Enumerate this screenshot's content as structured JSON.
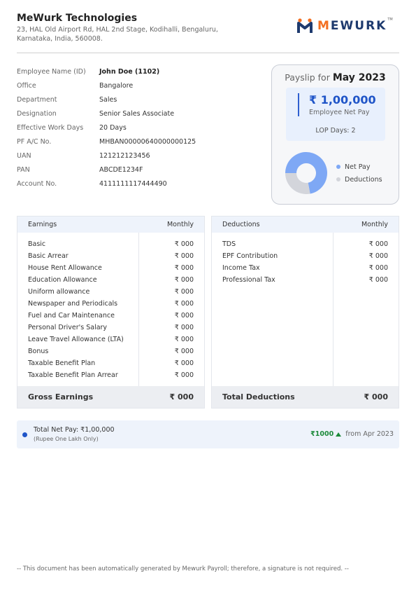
{
  "company": {
    "name": "MeWurk Technologies",
    "address": "23, HAL Old Airport Rd, HAL 2nd Stage, Kodihalli, Bengaluru, Karnataka, India, 560008.",
    "logo_text_m": "M",
    "logo_text_rest": "EWURK",
    "logo_tm": "TM",
    "logo_color_primary": "#1e3a6e",
    "logo_color_accent": "#f36f21"
  },
  "employee": [
    {
      "label": "Employee Name (ID)",
      "value": "John Doe (1102)"
    },
    {
      "label": "Office",
      "value": "Bangalore"
    },
    {
      "label": "Department",
      "value": "Sales"
    },
    {
      "label": "Designation",
      "value": "Senior Sales Associate"
    },
    {
      "label": "Effective Work Days",
      "value": "20 Days"
    },
    {
      "label": "PF A/C No.",
      "value": "MHBAN00000640000000125"
    },
    {
      "label": "UAN",
      "value": "121212123456"
    },
    {
      "label": "PAN",
      "value": "ABCDE1234F"
    },
    {
      "label": "Account No.",
      "value": "4111111117444490"
    }
  ],
  "summary": {
    "title_prefix": "Payslip for",
    "title_month": "May 2023",
    "net_amount": "₹ 1,00,000",
    "net_label": "Employee Net Pay",
    "lop": "LOP Days: 2",
    "chart": [
      {
        "name": "Net Pay",
        "share": 0.72,
        "color": "#7ea8f5"
      },
      {
        "name": "Deductions",
        "share": 0.28,
        "color": "#d3d5db"
      }
    ]
  },
  "earnings": {
    "header": "Earnings",
    "period": "Monthly",
    "rows": [
      {
        "name": "Basic",
        "amount": "₹ 000"
      },
      {
        "name": "Basic Arrear",
        "amount": "₹ 000"
      },
      {
        "name": "House Rent Allowance",
        "amount": "₹ 000"
      },
      {
        "name": "Education Allowance",
        "amount": "₹ 000"
      },
      {
        "name": "Uniform allowance",
        "amount": "₹ 000"
      },
      {
        "name": "Newspaper and Periodicals",
        "amount": "₹ 000"
      },
      {
        "name": "Fuel and Car Maintenance",
        "amount": "₹ 000"
      },
      {
        "name": "Personal Driver's Salary",
        "amount": "₹ 000"
      },
      {
        "name": "Leave Travel Allowance (LTA)",
        "amount": "₹ 000"
      },
      {
        "name": "Bonus",
        "amount": "₹ 000"
      },
      {
        "name": "Taxable Benefit Plan",
        "amount": "₹ 000"
      },
      {
        "name": "Taxable Benefit Plan Arrear",
        "amount": "₹ 000"
      }
    ],
    "total_label": "Gross Earnings",
    "total_amount": "₹ 000"
  },
  "deductions": {
    "header": "Deductions",
    "period": "Monthly",
    "rows": [
      {
        "name": "TDS",
        "amount": "₹ 000"
      },
      {
        "name": "EPF Contribution",
        "amount": "₹ 000"
      },
      {
        "name": "Income Tax",
        "amount": "₹ 000"
      },
      {
        "name": "Professional Tax",
        "amount": "₹ 000"
      }
    ],
    "total_label": "Total Deductions",
    "total_amount": "₹ 000"
  },
  "netpay": {
    "main": "Total Net Pay: ₹1,00,000",
    "words": "(Rupee One Lakh Only)",
    "diff": "₹1000",
    "from": "from Apr 2023"
  },
  "footer": "-- This document has been automatically generated by Mewurk Payroll; therefore, a signature is not required. --"
}
